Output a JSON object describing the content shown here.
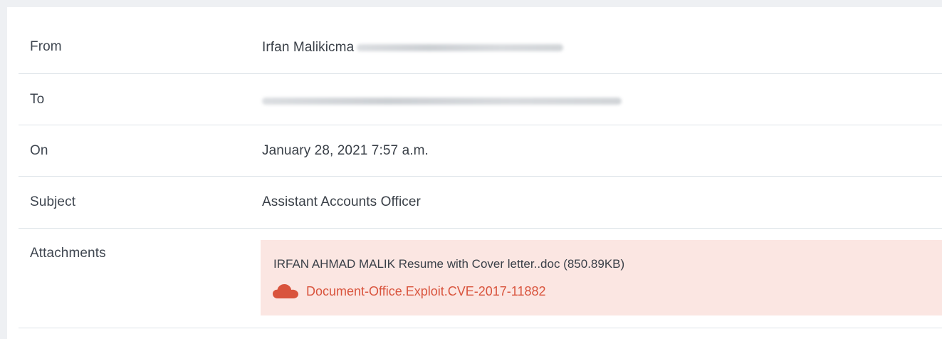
{
  "email": {
    "fields": [
      {
        "label": "From",
        "value": "Irfan Malikicma",
        "redacted": true
      },
      {
        "label": "To",
        "value": "",
        "redacted": true
      },
      {
        "label": "On",
        "value": "January 28, 2021 7:57 a.m."
      },
      {
        "label": "Subject",
        "value": "Assistant Accounts Officer"
      }
    ],
    "attachments": {
      "label": "Attachments",
      "file": "IRFAN AHMAD MALIK Resume with Cover letter..doc (850.89KB)",
      "threat": "Document-Office.Exploit.CVE-2017-11882",
      "threat_icon": "cloud-icon",
      "threat_color": "#d9543d",
      "box_color": "#fbe6e2"
    }
  }
}
